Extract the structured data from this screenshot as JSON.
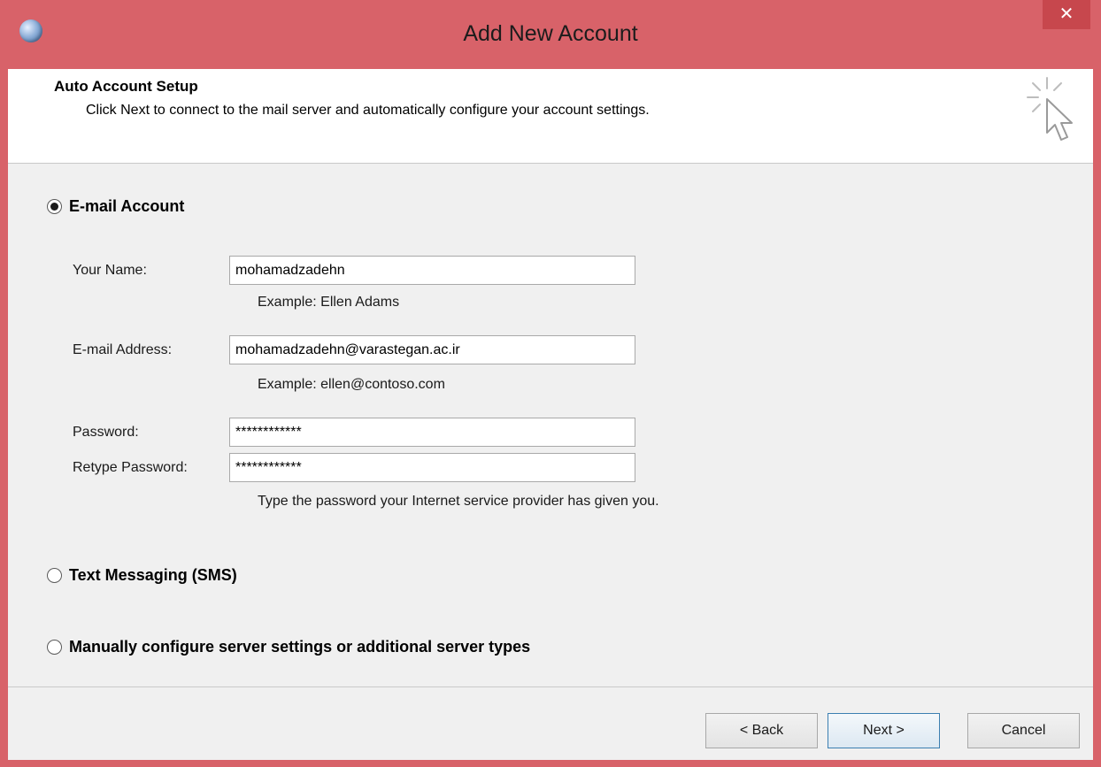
{
  "window": {
    "title": "Add New Account",
    "close_glyph": "✕"
  },
  "header": {
    "title": "Auto Account Setup",
    "subtitle": "Click Next to connect to the mail server and automatically configure your account settings."
  },
  "options": {
    "email_account": {
      "label": "E-mail Account",
      "selected": true
    },
    "text_messaging": {
      "label": "Text Messaging (SMS)",
      "selected": false
    },
    "manual": {
      "label": "Manually configure server settings or additional server types",
      "selected": false
    }
  },
  "form": {
    "name": {
      "label": "Your Name:",
      "value": "mohamadzadehn",
      "example": "Example: Ellen Adams"
    },
    "email": {
      "label": "E-mail Address:",
      "value": "mohamadzadehn@varastegan.ac.ir",
      "example": "Example: ellen@contoso.com"
    },
    "password": {
      "label": "Password:",
      "value": "************"
    },
    "retype_password": {
      "label": "Retype Password:",
      "value": "************"
    },
    "password_hint": "Type the password your Internet service provider has given you."
  },
  "buttons": {
    "back": "< Back",
    "next": "Next >",
    "cancel": "Cancel"
  },
  "colors": {
    "titlebar": "#d86269",
    "close_button": "#c7474d",
    "client_bg": "#f0f0f0"
  }
}
